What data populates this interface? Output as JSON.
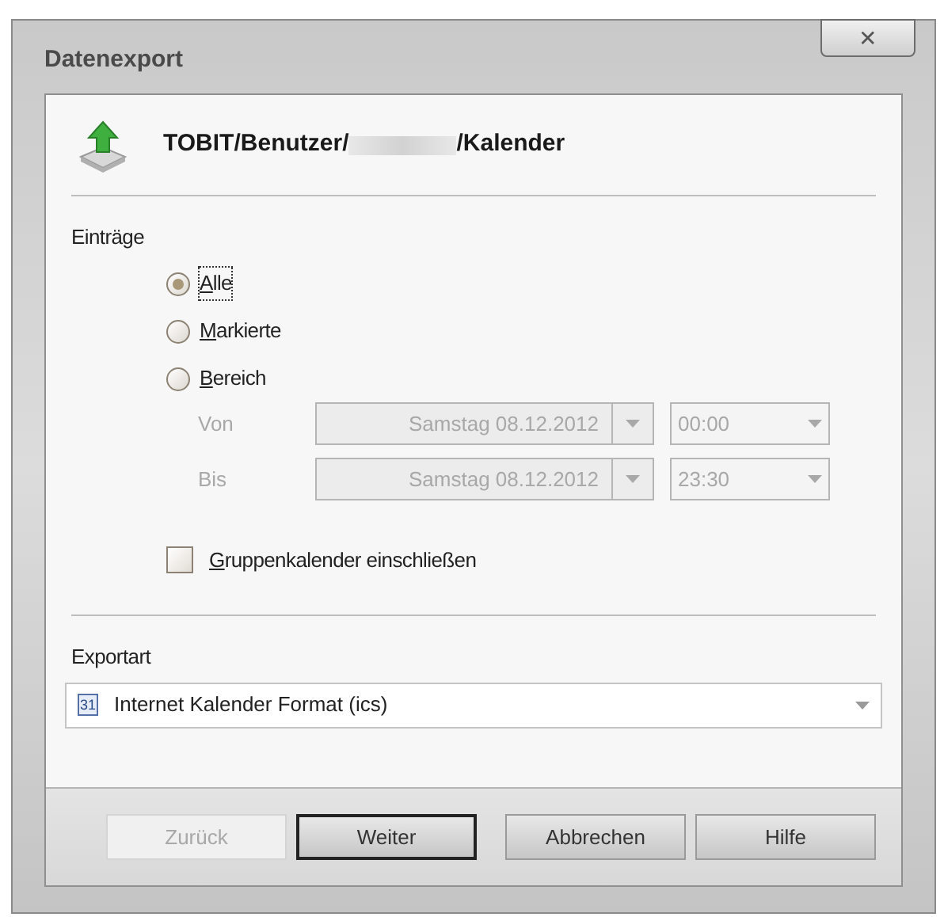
{
  "window": {
    "title": "Datenexport",
    "close": "✕"
  },
  "header": {
    "path_start": "TOBIT/Benutzer/",
    "path_end": "/Kalender"
  },
  "entries": {
    "label": "Einträge",
    "options": [
      {
        "label": "Alle",
        "selected": true,
        "focused": true
      },
      {
        "label": "Markierte",
        "selected": false,
        "focused": false
      },
      {
        "label": "Bereich",
        "selected": false,
        "focused": false
      }
    ],
    "range": [
      {
        "label": "Von",
        "date": "Samstag 08.12.2012",
        "time": "00:00",
        "disabled": true
      },
      {
        "label": "Bis",
        "date": "Samstag 08.12.2012",
        "time": "23:30",
        "disabled": true
      }
    ],
    "group_calendar": {
      "label": "Gruppenkalender einschließen",
      "checked": false
    }
  },
  "export": {
    "label": "Exportart",
    "icon_label": "31",
    "value": "Internet Kalender Format (ics)"
  },
  "buttons": [
    {
      "label": "Zurück",
      "disabled": true,
      "default": false
    },
    {
      "label": "Weiter",
      "disabled": false,
      "default": true
    },
    {
      "label": "Abbrechen",
      "disabled": false,
      "default": false
    },
    {
      "label": "Hilfe",
      "disabled": false,
      "default": false
    }
  ]
}
